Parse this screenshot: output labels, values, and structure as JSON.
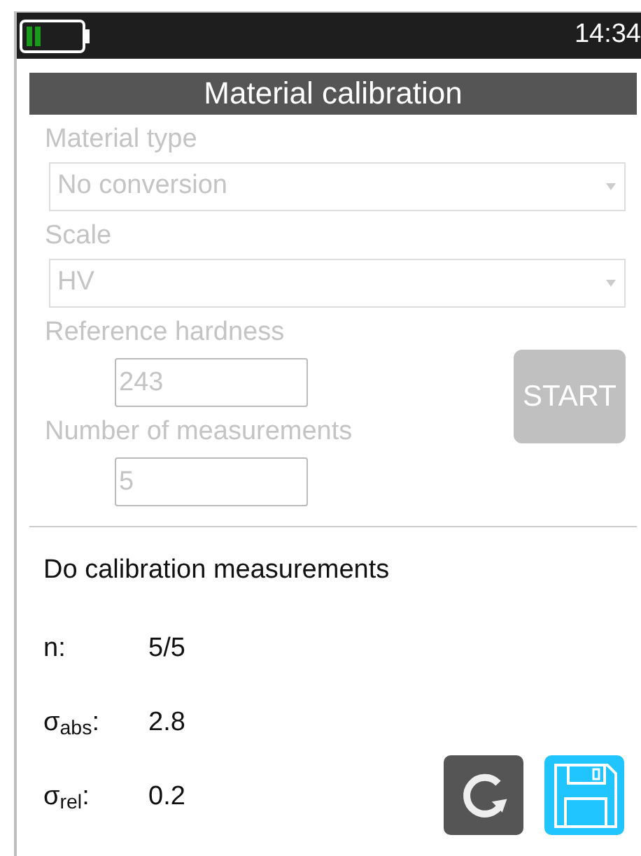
{
  "status_bar": {
    "time": "14:34"
  },
  "title": "Material calibration",
  "form": {
    "disabled": true,
    "material_type": {
      "label": "Material type",
      "value": "No conversion"
    },
    "scale": {
      "label": "Scale",
      "value": "HV"
    },
    "reference_hardness": {
      "label": "Reference hardness",
      "value": "243"
    },
    "number_of_measurements": {
      "label": "Number of measurements",
      "value": "5"
    },
    "start_button": {
      "label": "START",
      "disabled": true
    }
  },
  "results": {
    "heading": "Do calibration measurements",
    "rows": [
      {
        "label": "n:",
        "value": "5/5"
      },
      {
        "label": "σ$_{abs}$:",
        "value": "2.8"
      },
      {
        "label": "σ$_{rel}$:",
        "value": "0.2"
      }
    ]
  },
  "actions": [
    {
      "kind": "repeat"
    },
    {
      "kind": "save"
    }
  ]
}
